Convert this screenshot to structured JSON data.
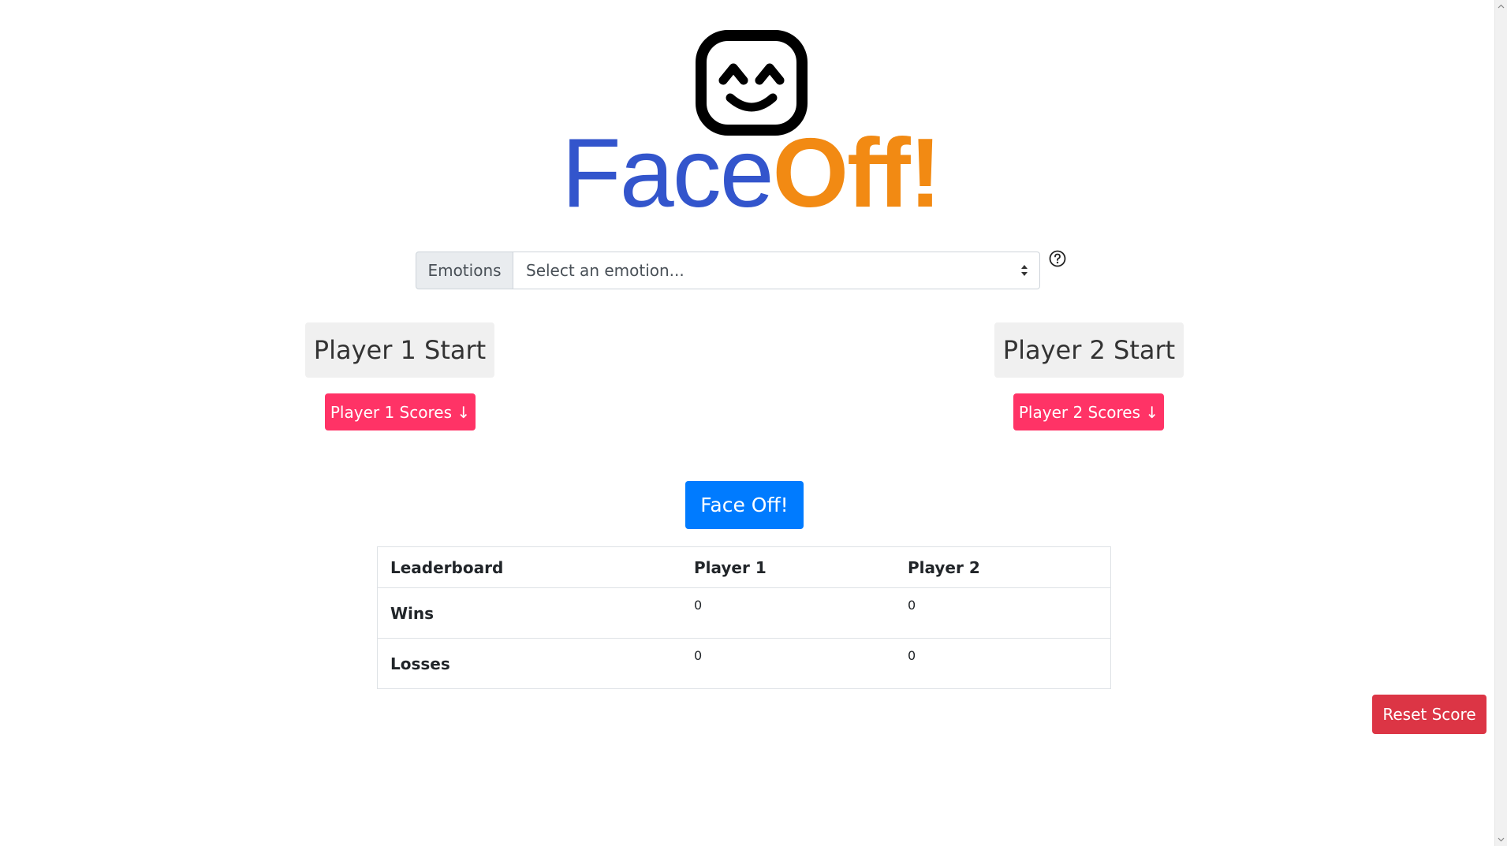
{
  "logo": {
    "icon": "smiley-face-icon",
    "word_face": "Face",
    "word_off": "Off!",
    "colors": {
      "face": "#3355cc",
      "off": "#f28a13"
    }
  },
  "emotion_select": {
    "label": "Emotions",
    "selected": "Select an emotion...",
    "help_icon": "question-circle-icon"
  },
  "players": [
    {
      "start_label": "Player 1 Start",
      "scores_label": "Player 1 Scores ↓"
    },
    {
      "start_label": "Player 2 Start",
      "scores_label": "Player 2 Scores ↓"
    }
  ],
  "faceoff_label": "Face Off!",
  "leaderboard": {
    "headers": [
      "Leaderboard",
      "Player 1",
      "Player 2"
    ],
    "rows": [
      {
        "label": "Wins",
        "values": [
          "0",
          "0"
        ]
      },
      {
        "label": "Losses",
        "values": [
          "0",
          "0"
        ]
      }
    ]
  },
  "reset_label": "Reset Score",
  "colors": {
    "scores_button": "#ff3366",
    "faceoff_button": "#007bff",
    "reset_button": "#dc3545"
  }
}
